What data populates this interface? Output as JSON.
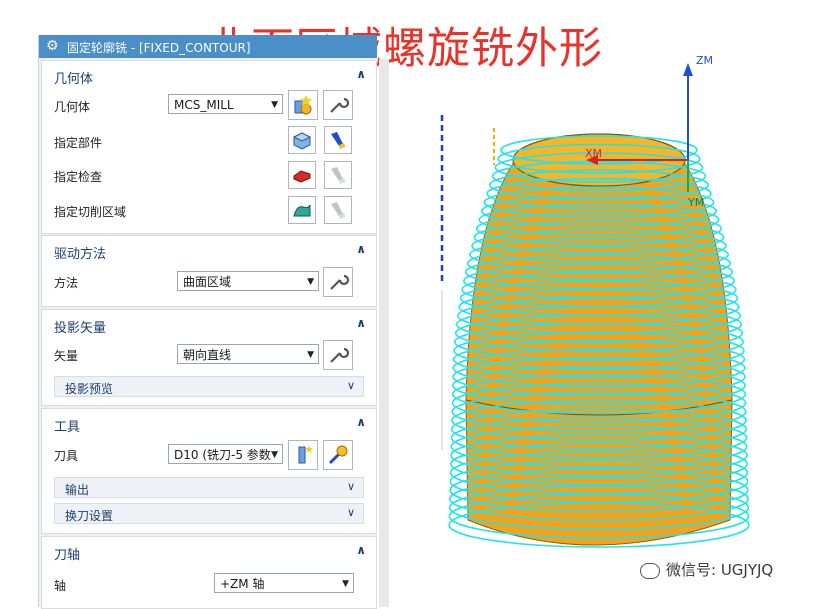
{
  "banner": {
    "text": "曲面区域螺旋铣外形",
    "color": "#e8332a"
  },
  "dialog": {
    "title": "固定轮廓铣 - [FIXED_CONTOUR]",
    "title_bar_color": "#4a8fc7",
    "sections": {
      "geometry": {
        "header": "几何体",
        "geometry_label": "几何体",
        "geometry_value": "MCS_MILL",
        "specify_part": "指定部件",
        "specify_check": "指定检查",
        "specify_cut_area": "指定切削区域"
      },
      "drive_method": {
        "header": "驱动方法",
        "method_label": "方法",
        "method_value": "曲面区域"
      },
      "projection_vector": {
        "header": "投影矢量",
        "vector_label": "矢量",
        "vector_value": "朝向直线",
        "preview": "投影预览"
      },
      "tool": {
        "header": "工具",
        "tool_label": "刀具",
        "tool_value": "D10 (铣刀-5 参数",
        "output": "输出",
        "tool_change": "换刀设置"
      },
      "tool_axis": {
        "header": "刀轴",
        "axis_label": "轴",
        "axis_value": "+ZM 轴"
      }
    }
  },
  "viewport": {
    "axes": {
      "z": "ZM",
      "x": "XM",
      "y": "YM"
    },
    "colors": {
      "part": "#f5a31a",
      "toolpath": "#20e3ef",
      "z_axis": "#1f4fcc",
      "x_axis": "#e02020",
      "y_axis": "#1aa84a"
    }
  },
  "watermark": {
    "text": "微信号: UGJYJQ"
  },
  "icons": [
    "gear-icon",
    "wrench-icon",
    "dropdown-arrow-icon",
    "collapse-icon",
    "expand-icon",
    "wechat-icon"
  ]
}
